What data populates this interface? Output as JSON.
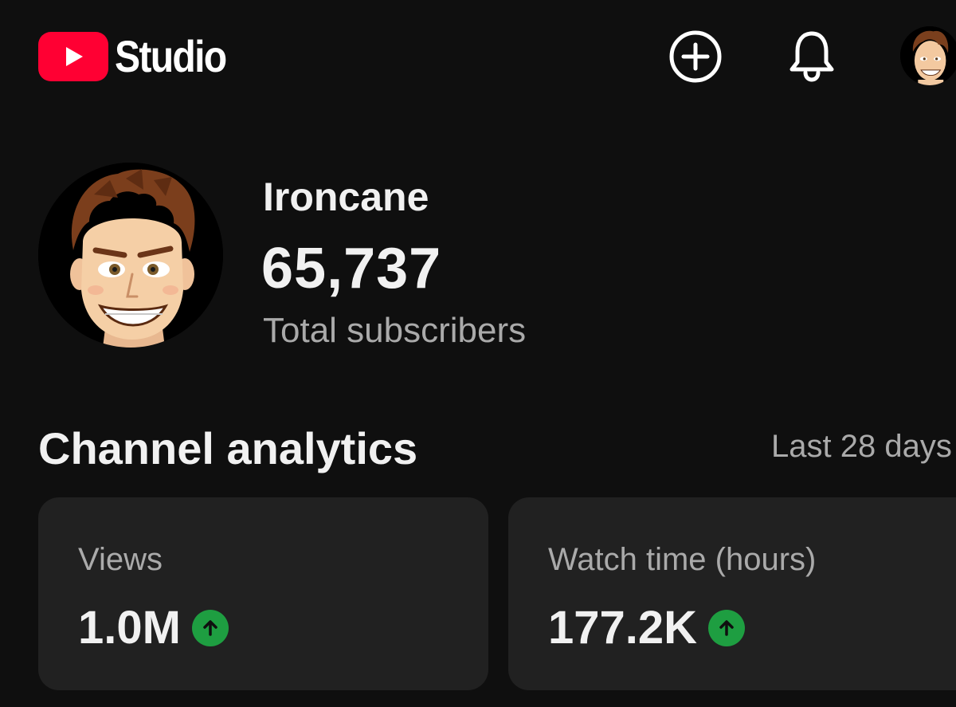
{
  "header": {
    "logo_text": "Studio",
    "icons": {
      "create": "plus-circle-icon",
      "notifications": "bell-icon",
      "account": "avatar"
    }
  },
  "channel": {
    "name": "Ironcane",
    "subscriber_count": "65,737",
    "subscriber_label": "Total subscribers"
  },
  "analytics": {
    "title": "Channel analytics",
    "period": "Last 28 days",
    "cards": [
      {
        "label": "Views",
        "value": "1.0M",
        "trend": "up"
      },
      {
        "label": "Watch time (hours)",
        "value": "177.2K",
        "trend": "up"
      }
    ]
  },
  "colors": {
    "background": "#0f0f0f",
    "card": "#212121",
    "brand_red": "#ff0033",
    "trend_up": "#1e9e41",
    "secondary_text": "#aaaaaa"
  }
}
